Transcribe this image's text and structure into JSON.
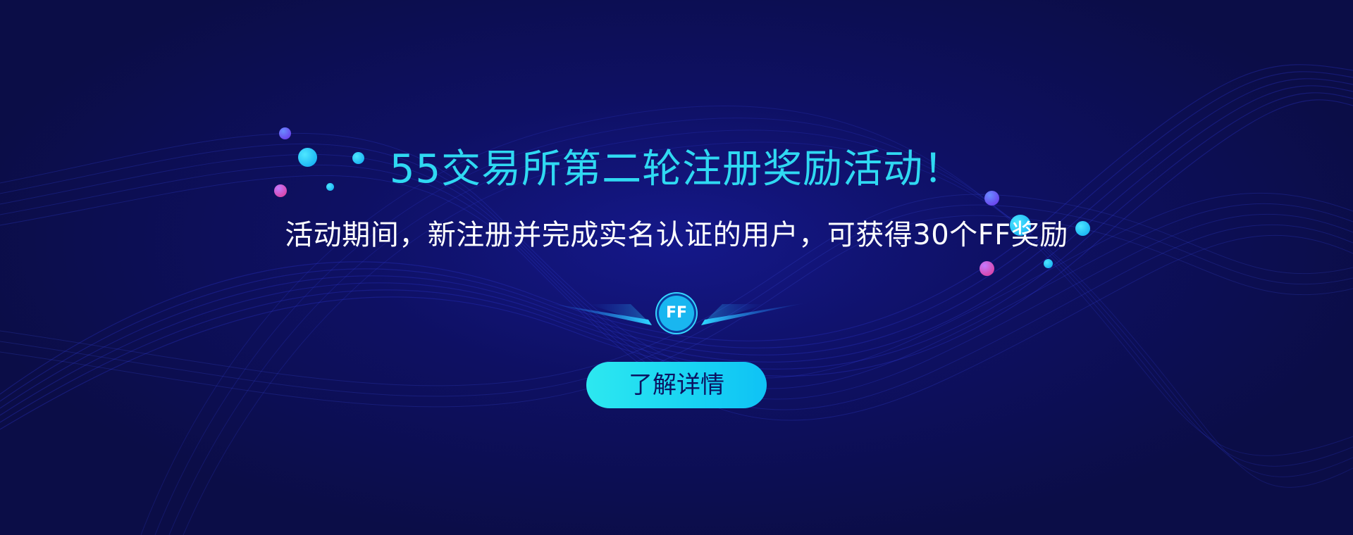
{
  "banner": {
    "headline": "55交易所第二轮注册奖励活动！",
    "subline": "活动期间，新注册并完成实名认证的用户，可获得30个FF奖励",
    "coin_label": "FF",
    "cta_label": "了解详情"
  },
  "colors": {
    "background": "#0b0d47",
    "headline": "#2fd9f2",
    "subline": "#ffffff",
    "cta_background": "#22dcf1",
    "cta_text": "#0b1361",
    "coin": "#19b6f0"
  },
  "icons": {
    "coin": "ff-token-icon",
    "wings": "light-beam-icon",
    "decor": "bubble-dot-icon"
  }
}
